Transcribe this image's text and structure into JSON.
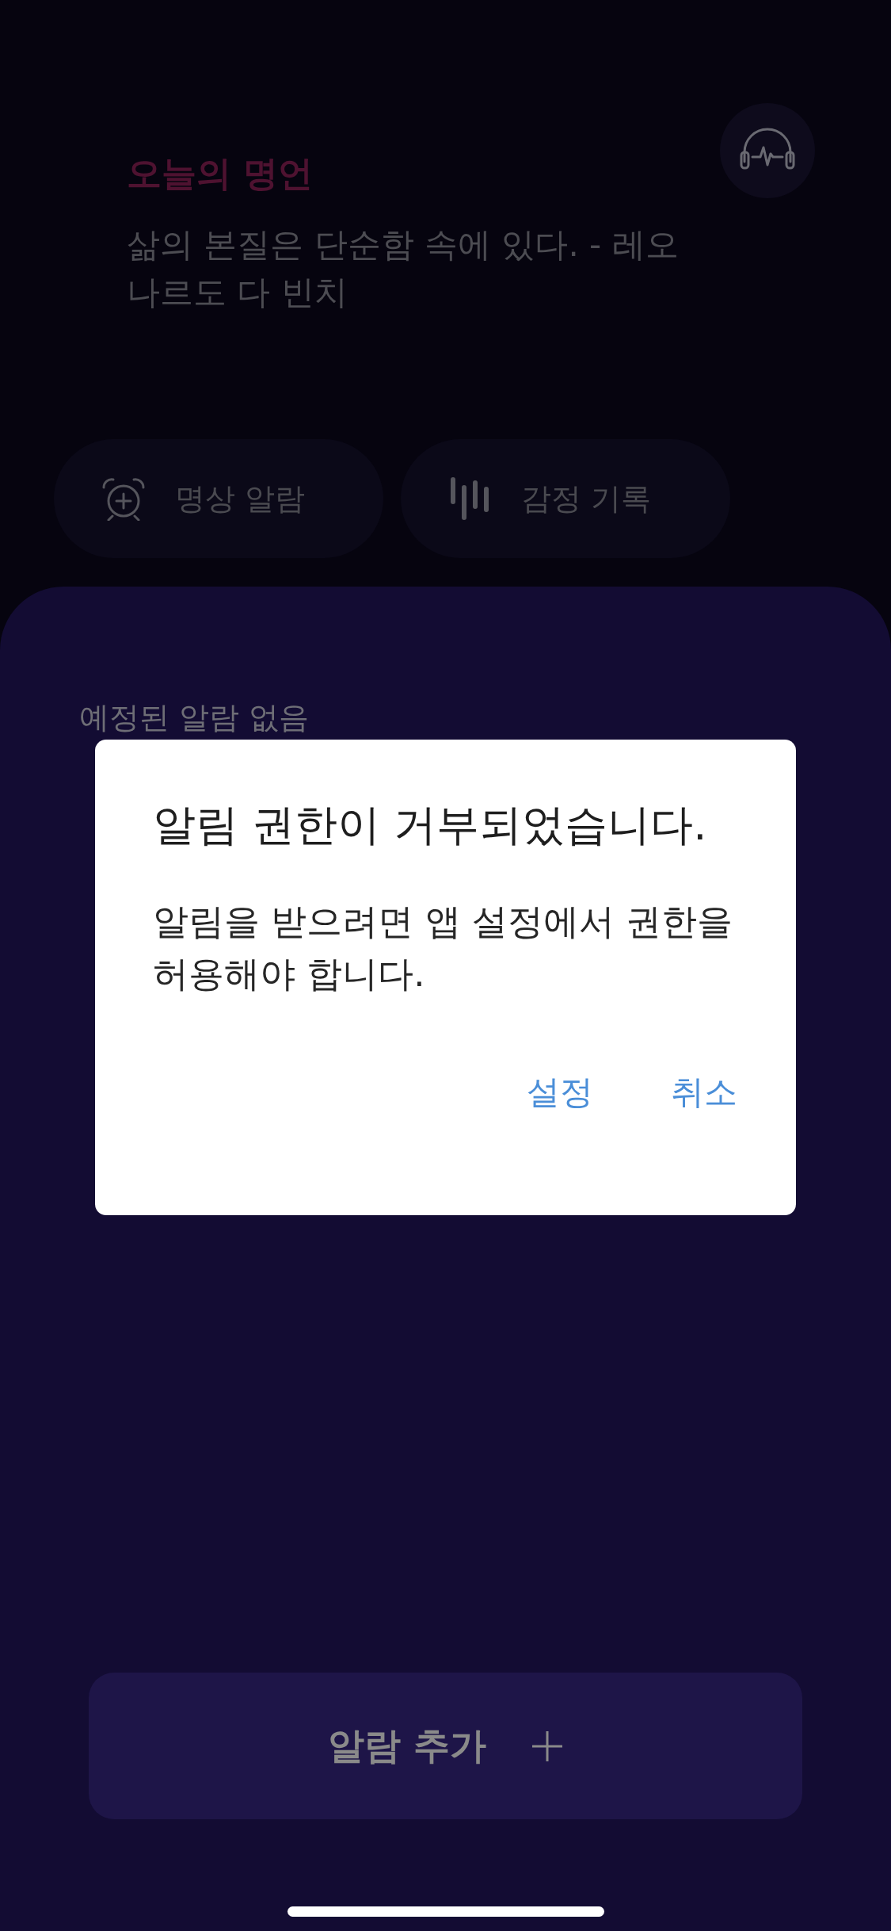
{
  "header": {
    "title": "오늘의 명언",
    "quote": "삶의 본질은 단순함 속에 있다. - 레오나르도 다 빈치"
  },
  "shortcuts": [
    {
      "kind": "alarm",
      "label": "명상 알람"
    },
    {
      "kind": "mood",
      "label": "감정 기록"
    }
  ],
  "alarms": {
    "empty_message": "예정된 알람 없음"
  },
  "add_button": {
    "label": "알람 추가"
  },
  "dialog": {
    "title": "알림 권한이 거부되었습니다.",
    "message": "알림을 받으려면 앱 설정에서 권한을 허용해야 합니다.",
    "buttons": [
      "설정",
      "취소"
    ]
  }
}
